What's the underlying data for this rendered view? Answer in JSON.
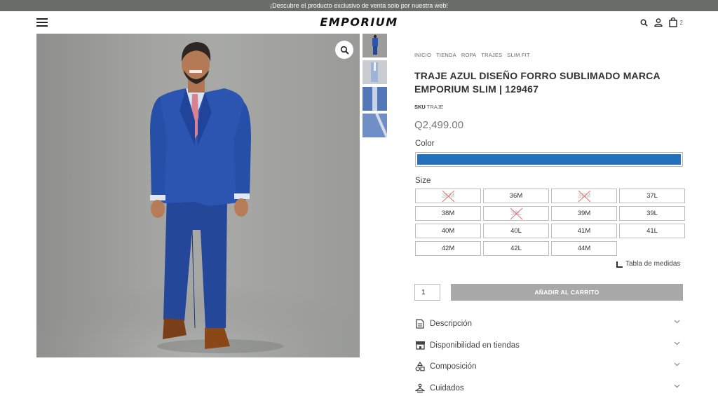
{
  "announcement": "¡Descubre el producto exclusivo de venta solo por nuestra web!",
  "brand": "EMPORIUM",
  "cart": {
    "count": "2"
  },
  "breadcrumb": [
    "INICIO",
    "TIENDA",
    "ROPA",
    "TRAJES",
    "SLIM FIT"
  ],
  "product": {
    "title": "TRAJE AZUL DISEÑO FORRO SUBLIMADO MARCA EMPORIUM SLIM | 129467",
    "sku_label": "SKU",
    "sku_value": "TRAJE",
    "price": "Q2,499.00"
  },
  "color": {
    "label": "Color",
    "swatch": "#2471bb"
  },
  "size": {
    "label": "Size",
    "options": [
      {
        "label": "36M",
        "available": false
      },
      {
        "label": "36M",
        "available": true
      },
      {
        "label": "36M",
        "available": false
      },
      {
        "label": "37L",
        "available": true
      },
      {
        "label": "38M",
        "available": true
      },
      {
        "label": "38L",
        "available": false
      },
      {
        "label": "39M",
        "available": true
      },
      {
        "label": "39L",
        "available": true
      },
      {
        "label": "40M",
        "available": true
      },
      {
        "label": "40L",
        "available": true
      },
      {
        "label": "41M",
        "available": true
      },
      {
        "label": "41L",
        "available": true
      },
      {
        "label": "42M",
        "available": true
      },
      {
        "label": "42L",
        "available": true
      },
      {
        "label": "44M",
        "available": true
      }
    ]
  },
  "size_chart_label": "Tabla de medidas",
  "quantity": "1",
  "add_to_cart": "AÑADIR AL CARRITO",
  "accordion": [
    {
      "label": "Descripción",
      "icon": "document-icon"
    },
    {
      "label": "Disponibilidad en tiendas",
      "icon": "store-icon"
    },
    {
      "label": "Composición",
      "icon": "shapes-icon"
    },
    {
      "label": "Cuidados",
      "icon": "hanger-icon"
    }
  ]
}
